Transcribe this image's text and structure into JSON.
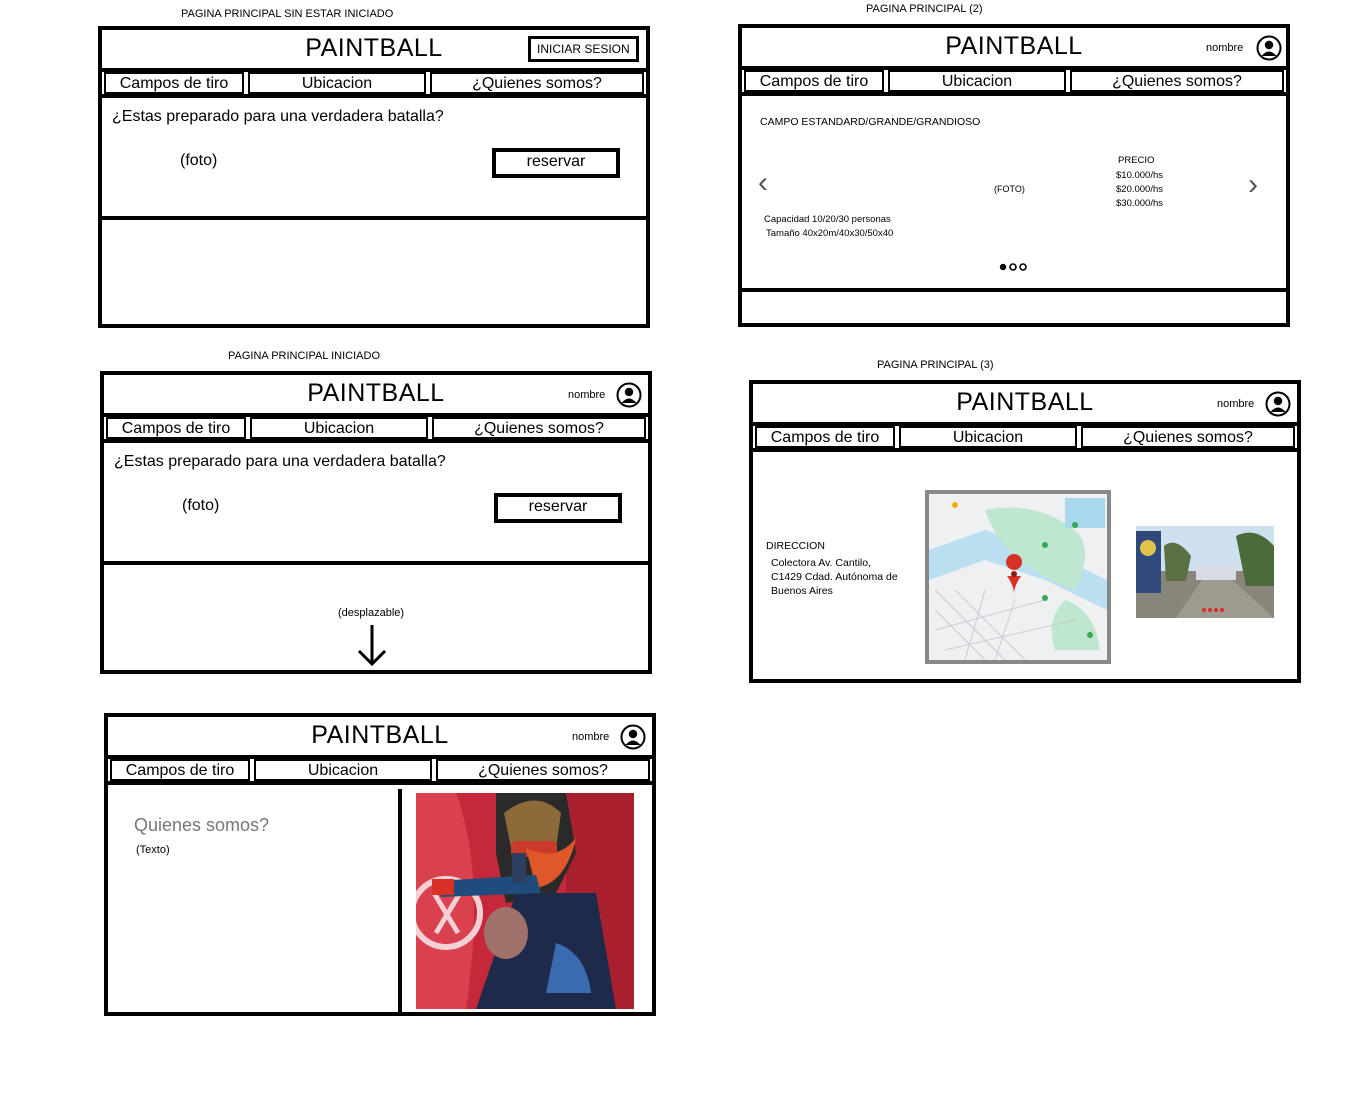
{
  "app_title": "PAINTBALL",
  "nav_tabs": [
    "Campos de tiro",
    "Ubicacion",
    "¿Quienes somos?"
  ],
  "user_name": "nombre",
  "screens": {
    "no_login": {
      "caption": "PAGINA PRINCIPAL  SIN ESTAR INICIADO",
      "login_button": "INICIAR SESION",
      "question": "¿Estas preparado para una verdadera batalla?",
      "photo": "(foto)",
      "reserve_button": "reservar"
    },
    "logged_in": {
      "caption": "PAGINA PRINCIPAL  INICIADO",
      "question": "¿Estas preparado para una verdadera batalla?",
      "photo": "(foto)",
      "reserve_button": "reservar",
      "scroll_hint": "(desplazable)"
    },
    "about": {
      "heading": "Quienes somos?",
      "text": "(Texto)"
    },
    "fields": {
      "caption": "PAGINA PRINCIPAL (2)",
      "field_title": "CAMPO ESTANDARD/GRANDE/GRANDIOSO",
      "photo": "(FOTO)",
      "price_label": "PRECIO",
      "prices": [
        "$10.000/hs",
        "$20.000/hs",
        "$30.000/hs"
      ],
      "capacity": "Capacidad 10/20/30 personas",
      "size": "Tamaño  40x20m/40x30/50x40"
    },
    "location": {
      "caption": "PAGINA PRINCIPAL (3)",
      "address_label": "DIRECCION",
      "address_lines": [
        "Colectora Av. Cantilo,",
        "C1429 Cdad. Autónoma de",
        "Buenos Aires"
      ]
    }
  }
}
